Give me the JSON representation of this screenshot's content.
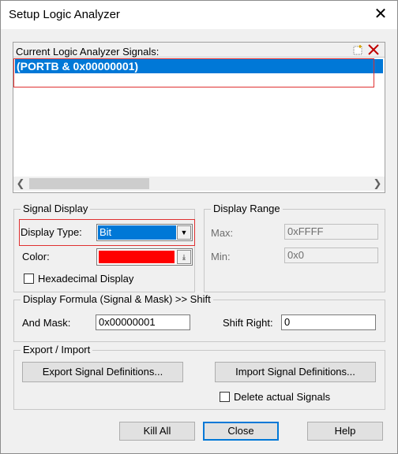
{
  "window": {
    "title": "Setup Logic Analyzer",
    "close_glyph": "✕"
  },
  "signals": {
    "header_label": "Current Logic Analyzer Signals:",
    "items": [
      {
        "label": "(PORTB & 0x00000001)",
        "selected": true
      }
    ]
  },
  "signal_display": {
    "group_label": "Signal Display",
    "display_type_label": "Display Type:",
    "display_type_value": "Bit",
    "color_label": "Color:",
    "color_value": "#ff0000",
    "hex_display_label": "Hexadecimal Display",
    "hex_display_checked": false
  },
  "display_range": {
    "group_label": "Display Range",
    "max_label": "Max:",
    "max_value": "0xFFFF",
    "min_label": "Min:",
    "min_value": "0x0"
  },
  "formula": {
    "group_label": "Display Formula (Signal & Mask) >> Shift",
    "and_mask_label": "And Mask:",
    "and_mask_value": "0x00000001",
    "shift_right_label": "Shift Right:",
    "shift_right_value": "0"
  },
  "export_import": {
    "group_label": "Export / Import",
    "export_button": "Export Signal Definitions...",
    "import_button": "Import Signal Definitions...",
    "delete_label": "Delete actual Signals",
    "delete_checked": false
  },
  "buttons": {
    "kill_all": "Kill All",
    "close": "Close",
    "help": "Help"
  },
  "colors": {
    "accent": "#0078d7",
    "highlight_box": "#e03030"
  },
  "icons": [
    "new-signal-icon",
    "delete-signal-icon",
    "scroll-left-icon",
    "scroll-right-icon",
    "dropdown-arrow-icon",
    "color-picker-arrow-icon"
  ]
}
